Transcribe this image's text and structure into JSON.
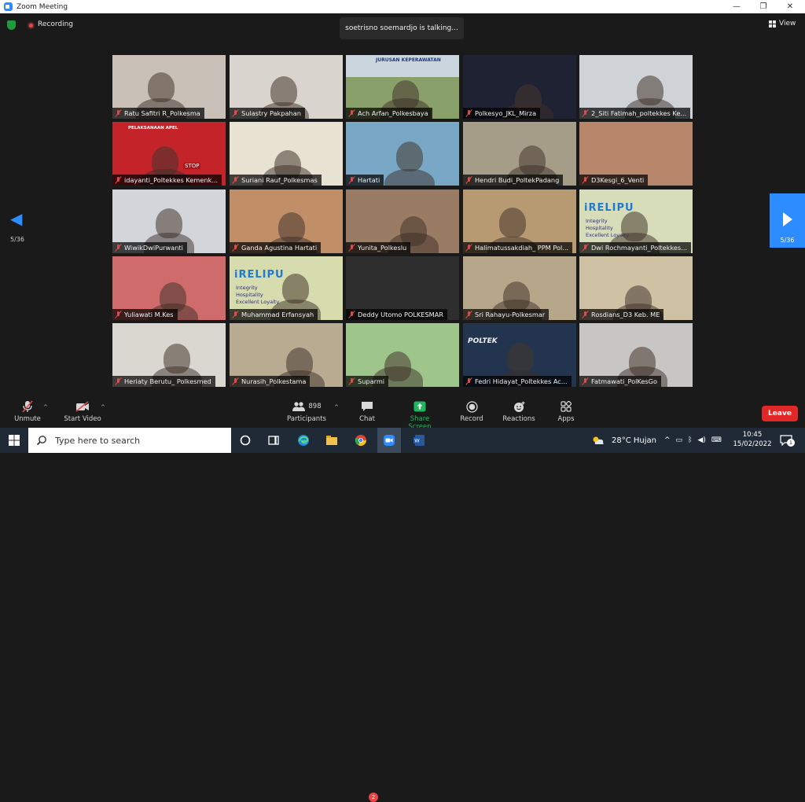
{
  "window": {
    "title": "Zoom Meeting",
    "minimize": "—",
    "restore": "❐",
    "close": "✕"
  },
  "meeting_top": {
    "recording_label": "Recording",
    "talking": "soetrisno soemardjo is talking...",
    "view_label": "View"
  },
  "gallery": {
    "page_left": "5/36",
    "page_right": "5/36",
    "participants": [
      {
        "name": "Ratu Safitri R_Polkesma",
        "bg": "#c9c1b8"
      },
      {
        "name": "Sulastry Pakpahan",
        "bg": "#d9d4cd"
      },
      {
        "name": "Ach Arfan_Polkesbaya",
        "bg": "#a6b585"
      },
      {
        "name": "Polkesyo_JKL_Mirza",
        "bg": "#1f2233"
      },
      {
        "name": "2_Siti Fatimah_poltekkes Ke...",
        "bg": "#cfd3d8"
      },
      {
        "name": "idayanti_Poltekkes Kemenk...",
        "bg": "#c4232a"
      },
      {
        "name": "Suriani Rauf_Polkesmas",
        "bg": "#e8e2d2"
      },
      {
        "name": "Hartati",
        "bg": "#79a8c6"
      },
      {
        "name": "Hendri Budi_PoltekPadang",
        "bg": "#a59d88"
      },
      {
        "name": "D3Kesgi_6_Venti",
        "bg": "#b8866a"
      },
      {
        "name": "WiwikDwiPurwanti",
        "bg": "#d2d6da"
      },
      {
        "name": "Ganda Agustina Hartati",
        "bg": "#c08f68"
      },
      {
        "name": "Yunita_Polkeslu",
        "bg": "#9a7b63"
      },
      {
        "name": "Halimatussakdiah_ PPM Pol...",
        "bg": "#b89a72"
      },
      {
        "name": "Dwi Rochmayanti_Poltekkes...",
        "bg": "#d7ddb8"
      },
      {
        "name": "Yuliawati M.Kes",
        "bg": "#cf6b6a"
      },
      {
        "name": "Muhammad Erfansyah",
        "bg": "#d6dcae"
      },
      {
        "name": "Deddy Utomo POLKESMAR",
        "bg": "#2e2e2e"
      },
      {
        "name": "Sri Rahayu-Polkesmar",
        "bg": "#b7a78a"
      },
      {
        "name": "Rosdians_D3 Keb. ME",
        "bg": "#cfc2a4"
      },
      {
        "name": "Heriaty Berutu_ Polkesmed",
        "bg": "#d9d7d0"
      },
      {
        "name": "Nurasih_Polkestama",
        "bg": "#b9aa92"
      },
      {
        "name": "Suparmi",
        "bg": "#9fc68a"
      },
      {
        "name": "Fedri Hidayat_Poltekkes Ac...",
        "bg": "#23344f"
      },
      {
        "name": "Fatmawati_PolKesGo",
        "bg": "#c8c6c4"
      }
    ],
    "banner_words": {
      "t3": "JURUSAN KEPERAWATAN",
      "t6": "PELAKSANAAN APEL",
      "t6b": "STOP",
      "brand": "iRELIPU",
      "w1": "Integrity",
      "w2": "Hospitality",
      "w3": "Excellent",
      "w4": "Loyalty",
      "tv": "POLTEK"
    }
  },
  "toolbar": {
    "unmute": "Unmute",
    "start_video": "Start Video",
    "participants": "Participants",
    "participants_count": "898",
    "chat": "Chat",
    "chat_badge": "2",
    "share_screen": "Share Screen",
    "record": "Record",
    "reactions": "Reactions",
    "apps": "Apps",
    "leave": "Leave"
  },
  "taskbar": {
    "search_placeholder": "Type here to search",
    "weather": "28°C  Hujan",
    "time": "10:45",
    "date": "15/02/2022",
    "notifications": "1"
  },
  "colors": {
    "accent": "#2d8cff",
    "leave": "#e02828",
    "share": "#1fb65c",
    "muted": "#e24a4a"
  }
}
